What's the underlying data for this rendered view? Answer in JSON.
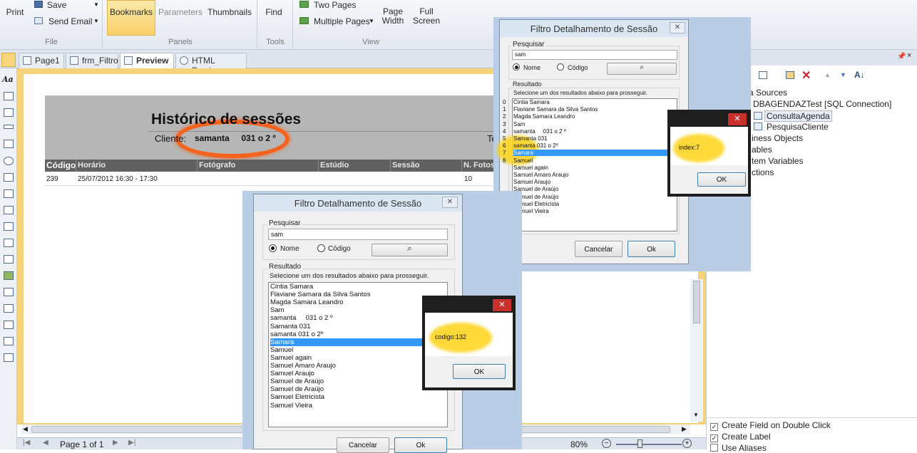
{
  "ribbon": {
    "buttons": {
      "print": "Print",
      "save": "Save",
      "send_email": "Send Email",
      "bookmarks": "Bookmarks",
      "parameters": "Parameters",
      "thumbnails": "Thumbnails",
      "find": "Find",
      "two_pages": "Two Pages",
      "multiple_pages": "Multiple Pages",
      "page_width_1": "Page",
      "page_width_2": "Width",
      "full_screen_1": "Full",
      "full_screen_2": "Screen"
    },
    "groups": {
      "file": "File",
      "panels": "Panels",
      "tools": "Tools",
      "view": "View"
    }
  },
  "tabs": [
    "Page1",
    "frm_Filtro",
    "Preview",
    "HTML Preview"
  ],
  "active_tab": "Preview",
  "report": {
    "title": "Histórico de sessões",
    "cliente_label": "Cliente:",
    "cliente_value": "samanta     031 o 2 º",
    "truncated_label": "Te",
    "columns": [
      "Código",
      "Horário",
      "Fotógrafo",
      "Estúdio",
      "Sessão",
      "N. Fotos"
    ],
    "row": {
      "codigo": "239",
      "horario": "25/07/2012 16:30 - 17:30",
      "nfotos": "10"
    }
  },
  "statusbar": {
    "page": "Page 1 of 1",
    "zoom": "80%"
  },
  "right_panel": {
    "tree": [
      "a Sources",
      "DBAGENDAZTest [SQL Connection]",
      "ConsultaAgenda",
      "PesquisaCliente",
      "iness Objects",
      "ables",
      "tem Variables",
      "ctions"
    ],
    "checkboxes": [
      {
        "label": "Create Field on Double Click",
        "checked": true
      },
      {
        "label": "Create Label",
        "checked": true
      },
      {
        "label": "Use Aliases",
        "checked": false
      }
    ]
  },
  "dialog": {
    "title": "Filtro Detalhamento de Sessão",
    "search_legend": "Pesquisar",
    "search_value": "sam",
    "radio_nome": "Nome",
    "radio_codigo": "Código",
    "result_legend": "Resultado",
    "result_hint": "Selecione um dos resultados abaixo para prosseguir.",
    "items": [
      "Cintia Samara",
      "Flaviane Samara da Silva Santos",
      "Magda Samara Leandro",
      "Sam",
      "samanta     031 o 2 º",
      "Samanta 031",
      "samanta 031 o 2º",
      "Samara",
      "Samuel",
      "Samuel again",
      "Samuel Amaro Araujo",
      "Samuel Araujo",
      "Samuel de Araújo",
      "Samuel de Araújo",
      "Samuel Eletricista",
      "Samuel Vieira"
    ],
    "indices": [
      "0",
      "1",
      "2",
      "3",
      "4",
      "5",
      "6",
      "7",
      "8"
    ],
    "selected_index": 7,
    "cancel": "Cancelar",
    "ok": "Ok"
  },
  "msg_top": {
    "text": "index:7",
    "ok": "OK"
  },
  "msg_bottom": {
    "text": "codigo:132",
    "ok": "OK"
  }
}
